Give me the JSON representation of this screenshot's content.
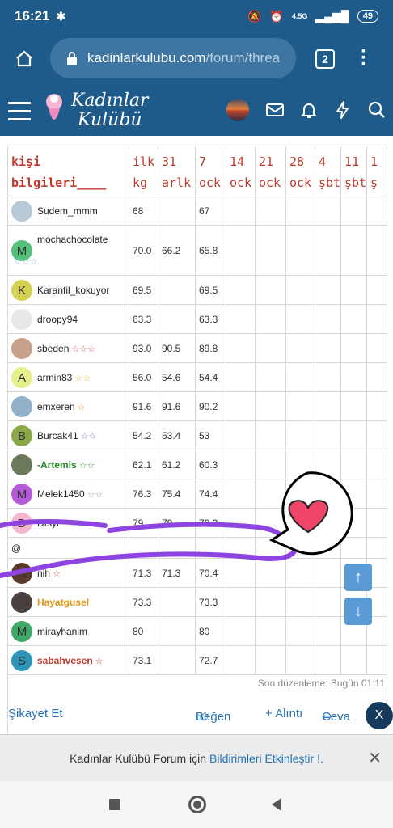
{
  "status": {
    "time": "16:21",
    "battery": "49",
    "net": "4.5G"
  },
  "browser": {
    "url_host": "kadinlarkulubu.com",
    "url_path": "/forum/threa",
    "tab_count": "2"
  },
  "site": {
    "logo_line1": "Kadınlar",
    "logo_line2": "Kulübü"
  },
  "table": {
    "headers": [
      {
        "l1": "kişi",
        "l2": "bilgileri____"
      },
      {
        "l1": "ilk",
        "l2": "kg"
      },
      {
        "l1": "31",
        "l2": "arlk"
      },
      {
        "l1": "7",
        "l2": "ock"
      },
      {
        "l1": "14",
        "l2": "ock"
      },
      {
        "l1": "21",
        "l2": "ock"
      },
      {
        "l1": "28",
        "l2": "ock"
      },
      {
        "l1": "4",
        "l2": "şbt"
      },
      {
        "l1": "11",
        "l2": "şbt"
      },
      {
        "l1": "1",
        "l2": "ş"
      }
    ],
    "rows": [
      {
        "name": "Sudem_mmm",
        "stars": "",
        "avatar": "",
        "v1": "68",
        "v2": "",
        "v3": "67"
      },
      {
        "name": "mochachocolate",
        "stars": "☆☆☆",
        "avatar": "M",
        "v1": "70.0",
        "v2": "66.2",
        "v3": "65.8"
      },
      {
        "name": "Karanfil_kokuyor",
        "stars": "",
        "avatar": "K",
        "v1": "69.5",
        "v2": "",
        "v3": "69.5"
      },
      {
        "name": "droopy94",
        "stars": "",
        "avatar": "",
        "v1": "63.3",
        "v2": "",
        "v3": "63.3"
      },
      {
        "name": "sbeden",
        "stars": "☆☆☆",
        "avatar": "",
        "v1": "93.0",
        "v2": "90.5",
        "v3": "89.8"
      },
      {
        "name": "armin83",
        "stars": "☆☆",
        "avatar": "A",
        "v1": "56.0",
        "v2": "54.6",
        "v3": "54.4"
      },
      {
        "name": "emxeren",
        "stars": "☆",
        "avatar": "",
        "v1": "91.6",
        "v2": "91.6",
        "v3": "90.2"
      },
      {
        "name": "Burcak41",
        "stars": "☆☆",
        "avatar": "B",
        "v1": "54.2",
        "v2": "53.4",
        "v3": "53"
      },
      {
        "name": "-Artemis",
        "stars": "☆☆",
        "avatar": "",
        "v1": "62.1",
        "v2": "61.2",
        "v3": "60.3"
      },
      {
        "name": "Melek1450",
        "stars": "☆☆",
        "avatar": "M",
        "v1": "76.3",
        "v2": "75.4",
        "v3": "74.4"
      },
      {
        "name": "Dfsyr",
        "stars": "",
        "avatar": "D",
        "v1": "79",
        "v2": "79",
        "v3": "79.3"
      },
      {
        "name": "@",
        "stars": "",
        "avatar": "",
        "v1": "",
        "v2": "",
        "v3": ""
      },
      {
        "name": "nih",
        "stars": "☆",
        "avatar": "N",
        "v1": "71.3",
        "v2": "71.3",
        "v3": "70.4"
      },
      {
        "name": "Hayatgusel",
        "stars": "",
        "avatar": "",
        "v1": "73.3",
        "v2": "",
        "v3": "73.3"
      },
      {
        "name": "mirayhanim",
        "stars": "",
        "avatar": "M",
        "v1": "80",
        "v2": "",
        "v3": "80"
      },
      {
        "name": "sabahvesen",
        "stars": "☆",
        "avatar": "S",
        "v1": "73.1",
        "v2": "",
        "v3": "72.7"
      }
    ]
  },
  "edit_note": "Son düzenleme: Bugün 01:11",
  "actions": {
    "report": "Şikayet Et",
    "like": "Beğen",
    "quote": "+ Alıntı",
    "reply": "Ceva"
  },
  "notif": {
    "text": "Kadınlar Kulübü Forum için",
    "link": "Bildirimleri Etkinleştir !."
  },
  "colors": {
    "header_bg": "#1e5a8a",
    "accent": "#2471b5",
    "header_text": "#c0392b"
  }
}
